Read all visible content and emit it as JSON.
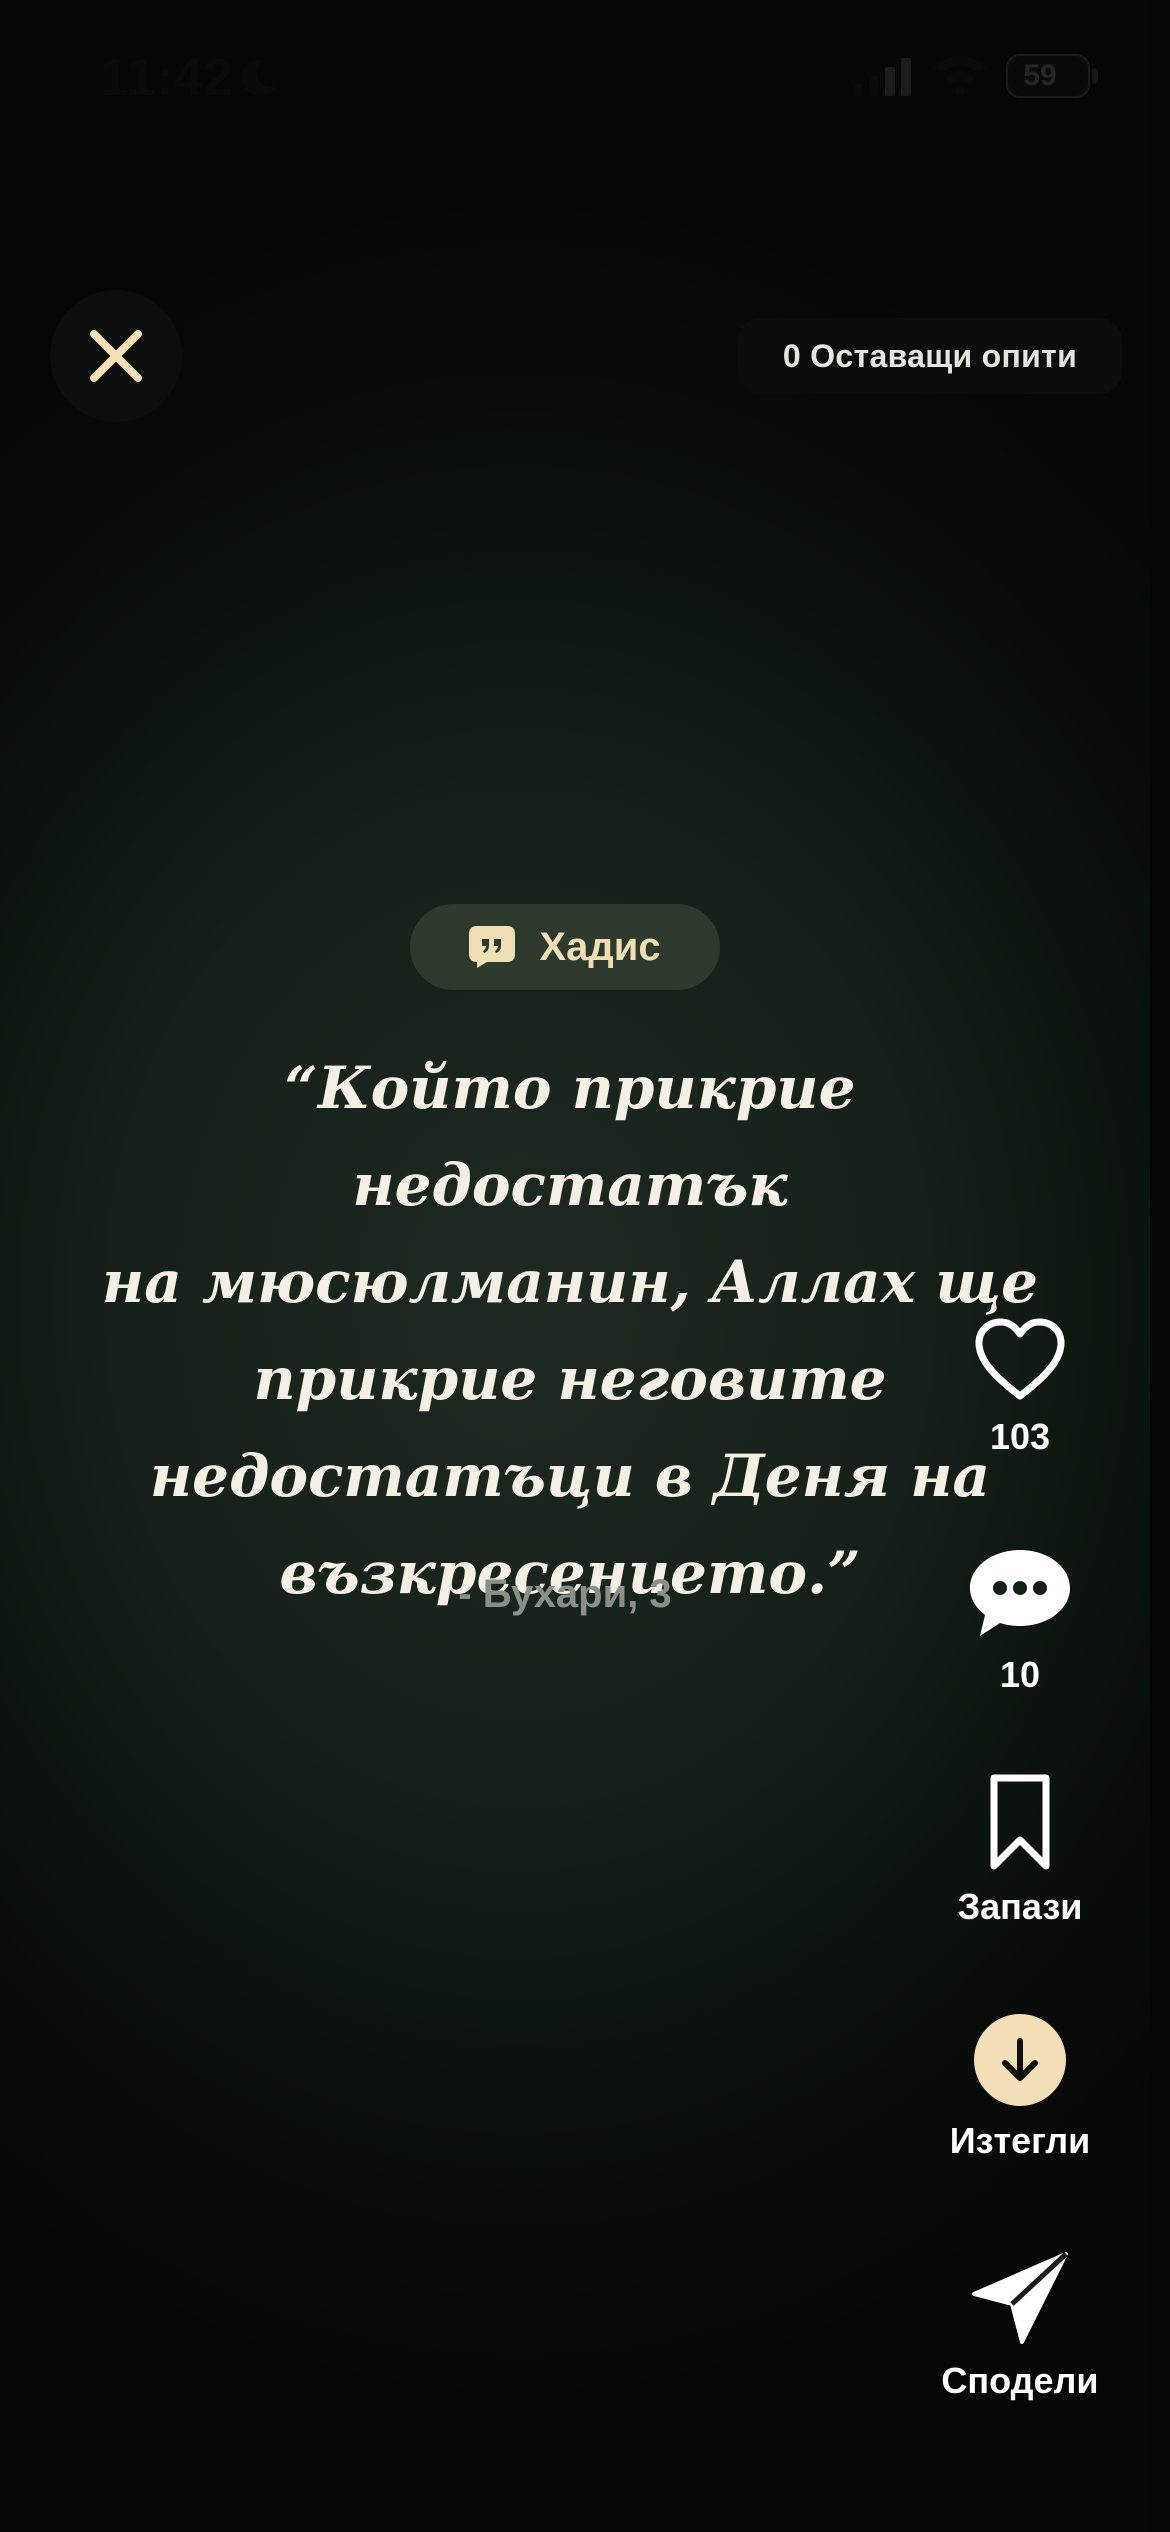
{
  "status_bar": {
    "time": "11:42",
    "battery": "59",
    "icons": [
      "moon-icon",
      "cellular-signal-icon",
      "wifi-icon",
      "battery-icon"
    ]
  },
  "top": {
    "close_icon": "close-icon",
    "attempts_label": "0 Оставащи опити"
  },
  "card": {
    "category_icon": "quote-bubble-icon",
    "category_label": "Хадис",
    "quote_lines": [
      "“Който прикрие недостатък",
      "на мюсюлманин, Аллах ще",
      "прикрие неговите",
      "недостатъци в Деня на",
      "възкресението.”"
    ],
    "source": "- Бухари, 3"
  },
  "actions": {
    "like_icon": "heart-icon",
    "like_count": "103",
    "comment_icon": "comment-icon",
    "comment_count": "10",
    "save_icon": "bookmark-icon",
    "save_label": "Запази",
    "download_icon": "download-icon",
    "download_label": "Изтегли",
    "share_icon": "send-icon",
    "share_label": "Сподели"
  },
  "colors": {
    "accent": "#f2dfb8",
    "background": "#152018",
    "chip_background": "#2f3a2f"
  }
}
